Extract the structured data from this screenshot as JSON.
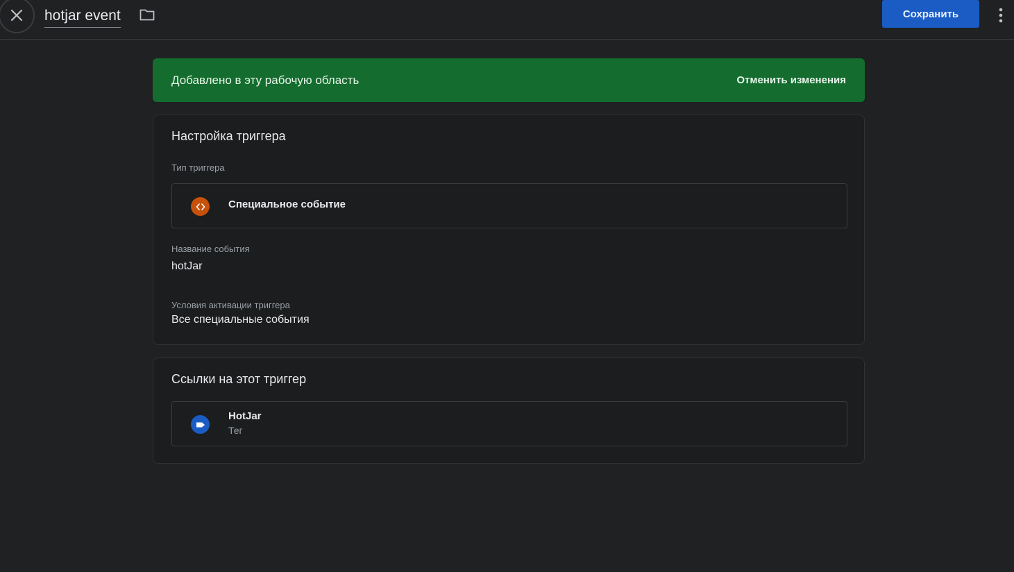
{
  "header": {
    "title": "hotjar event",
    "save_label": "Сохранить"
  },
  "banner": {
    "text": "Добавлено в эту рабочую область",
    "action_label": "Отменить изменения"
  },
  "trigger_config": {
    "title": "Настройка триггера",
    "type_label": "Тип триггера",
    "type_value": "Специальное событие",
    "event_name_label": "Название события",
    "event_name_value": "hotJar",
    "conditions_label": "Условия активации триггера",
    "conditions_value": "Все специальные события"
  },
  "references": {
    "title": "Ссылки на этот триггер",
    "items": [
      {
        "name": "HotJar",
        "kind": "Тег"
      }
    ]
  },
  "colors": {
    "accent": "#1a5cc4",
    "banner": "#146c2e",
    "trigger_icon": "#c5510b",
    "tag_icon": "#1a5cc4"
  },
  "icons": {
    "close": "close-icon",
    "folder": "folder-icon",
    "more": "more-vert-icon",
    "trigger_type": "code-icon",
    "tag": "tag-icon"
  }
}
